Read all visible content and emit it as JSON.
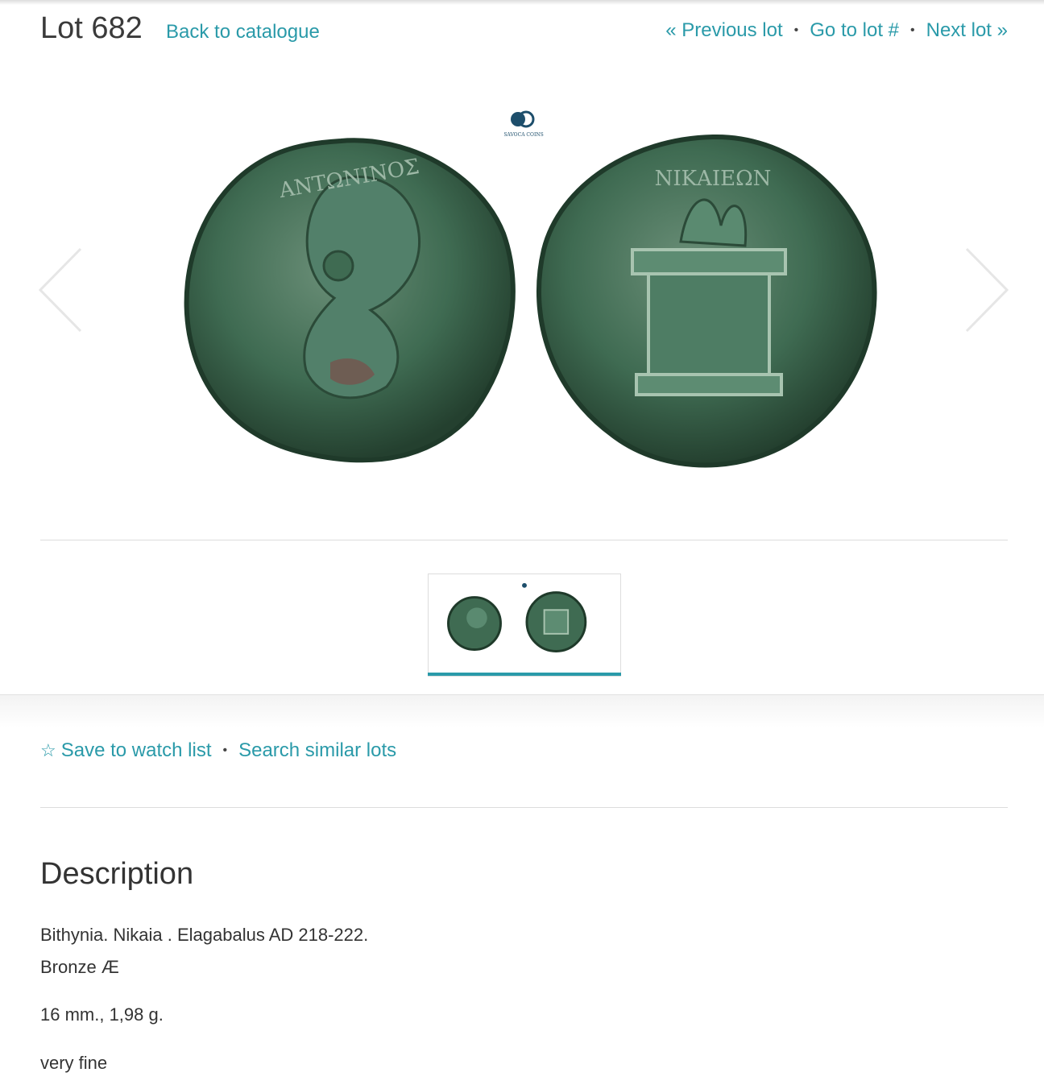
{
  "header": {
    "lot_title": "Lot 682",
    "back_link": "Back to catalogue",
    "nav": {
      "previous": "« Previous lot",
      "goto": "Go to lot #",
      "next": "Next lot »",
      "separator": "•"
    }
  },
  "gallery": {
    "logo_text": "SAVOCA COINS",
    "logo_monogram": "SC",
    "obverse_legend": "ΑΝΤΩΝΙΝΟΣ",
    "reverse_legend": "ΝΙΚΑΙΕΩΝ"
  },
  "actions": {
    "watch_icon": "star-outline-icon",
    "watch_label": "Save to watch list",
    "separator": "•",
    "similar_label": "Search similar lots"
  },
  "description": {
    "heading": "Description",
    "line1": "Bithynia. Nikaia . Elagabalus AD 218-222.",
    "line2": "Bronze Æ",
    "line3": "16 mm., 1,98 g.",
    "line4": "very fine"
  },
  "colors": {
    "link": "#2a9aa9",
    "coin_patina": "#3f6b52",
    "active_thumb_bar": "#2a9aa9"
  }
}
